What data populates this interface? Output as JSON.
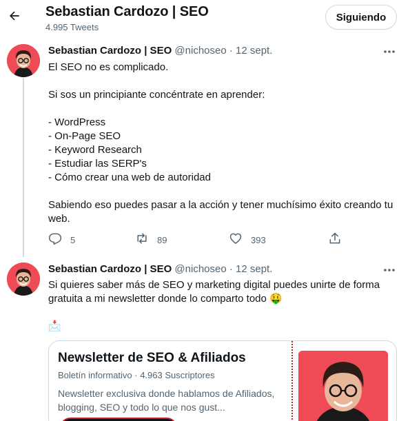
{
  "header": {
    "back_icon": "arrow-left-icon",
    "title": "Sebastian Cardozo | SEO",
    "tweet_count": "4.995 Tweets",
    "follow_label": "Siguiendo"
  },
  "tweets": [
    {
      "name": "Sebastian Cardozo | SEO",
      "meta": " @nichoseo · 12 sept.",
      "lines": [
        "El SEO no es complicado.",
        "",
        "Si sos un principiante concéntrate en aprender:",
        "",
        "- WordPress",
        "- On-Page SEO",
        "- Keyword Research",
        "- Estudiar las SERP's",
        "- Cómo crear una web de autoridad",
        "",
        "Sabiendo eso puedes pasar a la acción y tener muchísimo éxito creando tu",
        "web."
      ],
      "replies": "5",
      "retweets": "89",
      "likes": "393"
    },
    {
      "name": "Sebastian Cardozo | SEO",
      "meta": " @nichoseo · 12 sept.",
      "lines": [
        "Si quieres saber más de SEO y marketing digital puedes unirte de forma",
        "gratuita a mi newsletter donde lo comparto todo 🤑",
        "",
        "📩"
      ]
    }
  ],
  "card": {
    "title": "Newsletter de SEO & Afiliados",
    "subtitle": "Boletín informativo · 4.963 Suscriptores",
    "description": "Newsletter exclusiva donde hablamos de Afiliados, blogging, SEO y todo lo que nos gust..."
  },
  "colors": {
    "accent_red": "#ef4b57",
    "muted_text": "#536471",
    "border": "#cfd9de"
  }
}
